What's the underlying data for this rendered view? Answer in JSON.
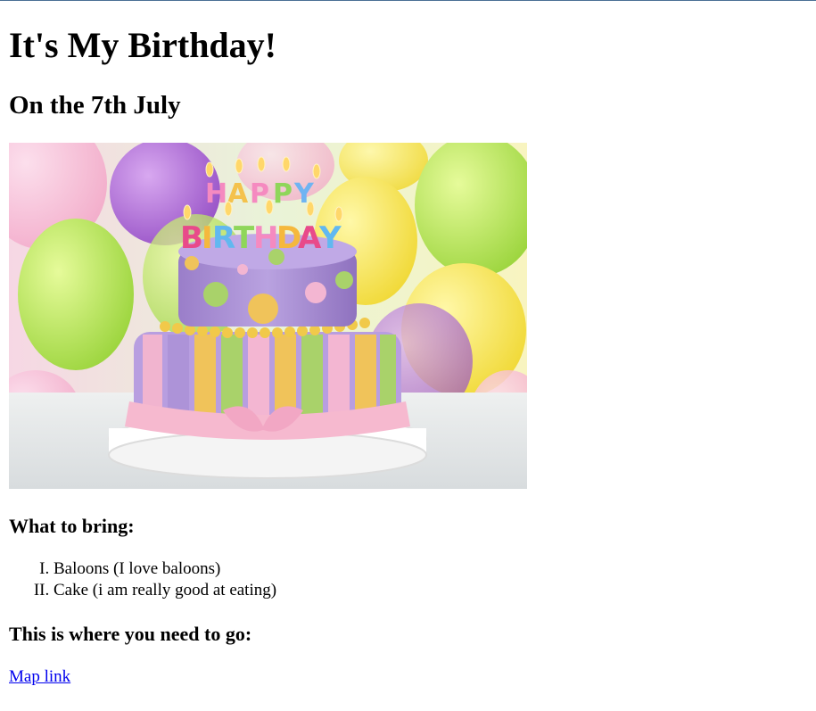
{
  "page": {
    "title": "It's My Birthday!",
    "subtitle": "On the 7th July",
    "image": {
      "description": "birthday-cake-photo",
      "cake_text_line1": "HAPPY",
      "cake_text_line2": "BIRTHDAY"
    },
    "bring": {
      "heading": "What to bring:",
      "items": [
        "Baloons (I love baloons)",
        "Cake (i am really good at eating)"
      ]
    },
    "directions": {
      "heading": "This is where you need to go:",
      "link_label": "Map link"
    }
  },
  "colors": {
    "link": "#0000ee",
    "top_border": "#4a6f95"
  }
}
